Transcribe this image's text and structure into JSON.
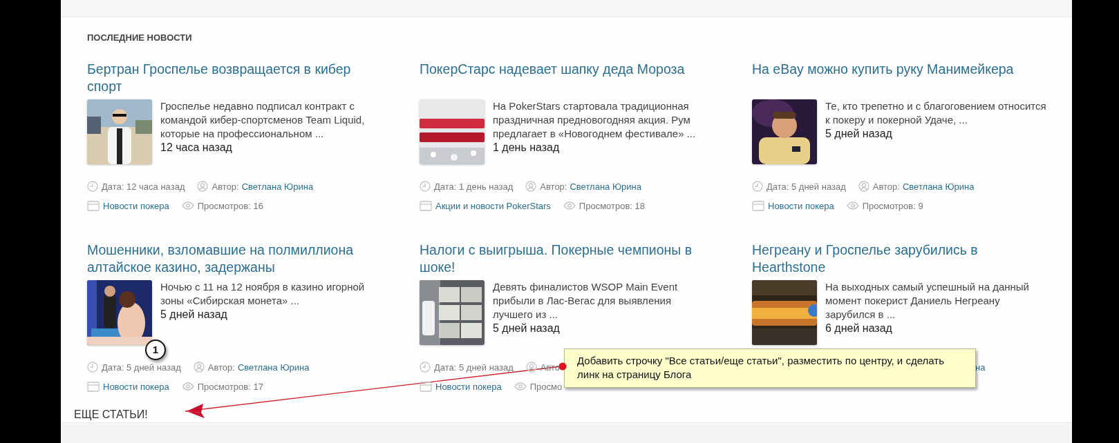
{
  "section_title": "ПОСЛЕДНИЕ НОВОСТИ",
  "articles": [
    {
      "title": "Бертран Гроспелье возвращается в кибер спорт",
      "excerpt": "Гроспелье недавно подписал контракт с командой кибер-спортсменов Team Liquid, которые на профессиональном ...",
      "age": "12 часа назад",
      "meta": {
        "date": "Дата: 12 часа назад",
        "author_label": "Автор:",
        "author": "Светлана Юрина",
        "category": "Новости покера",
        "views": "Просмотров: 16"
      }
    },
    {
      "title": "ПокерСтарс надевает шапку деда Мороза",
      "excerpt": "На PokerStars стартовала традиционная праздничная предновогодняя акция. Рум предлагает в «Новогоднем фестивале» ...",
      "age": "1 день назад",
      "meta": {
        "date": "Дата: 1 день назад",
        "author_label": "Автор:",
        "author": "Светлана Юрина",
        "category": "Акции и новости PokerStars",
        "views": "Просмотров: 18"
      }
    },
    {
      "title": "На eBay можно купить руку Манимейкера",
      "excerpt": "Те, кто трепетно и с благоговением относится к покеру и покерной Удаче, ...",
      "age": "5 дней назад",
      "meta": {
        "date": "Дата: 5 дней назад",
        "author_label": "Автор:",
        "author": "Светлана Юрина",
        "category": "Новости покера",
        "views": "Просмотров: 9"
      }
    },
    {
      "title": "Мошенники, взломавшие на полмиллиона алтайское казино, задержаны",
      "excerpt": "Ночью с 11 на 12 ноября в казино игорной зоны «Сибирская монета» ...",
      "age": "5 дней назад",
      "meta": {
        "date": "Дата: 5 дней назад",
        "author_label": "Автор:",
        "author": "Светлана Юрина",
        "category": "Новости покера",
        "views": "Просмотров: 17"
      }
    },
    {
      "title": "Налоги с выигрыша. Покерные чемпионы в шоке!",
      "excerpt": "Девять финалистов WSOP Main Event прибыли в Лас-Вегас для выявления лучшего из ...",
      "age": "5 дней назад",
      "meta": {
        "date": "Дата: 5 дней назад",
        "author_label": "Авто",
        "category": "Новости покера",
        "views": "Просмо"
      }
    },
    {
      "title": "Негреану и Гроспелье зарубились в Hearthstone",
      "excerpt": "На выходных самый успешный на данный момент покерист Даниель Негреану зарубился в ...",
      "age": "6 дней назад",
      "meta": {
        "author": "на"
      }
    }
  ],
  "more_link": "ЕЩЕ СТАТЬИ!",
  "annotation": {
    "badge": "1",
    "note": "Добавить строчку \"Все статьи/еще статьи\", разместить по центру, и сделать линк на страницу Блога"
  }
}
